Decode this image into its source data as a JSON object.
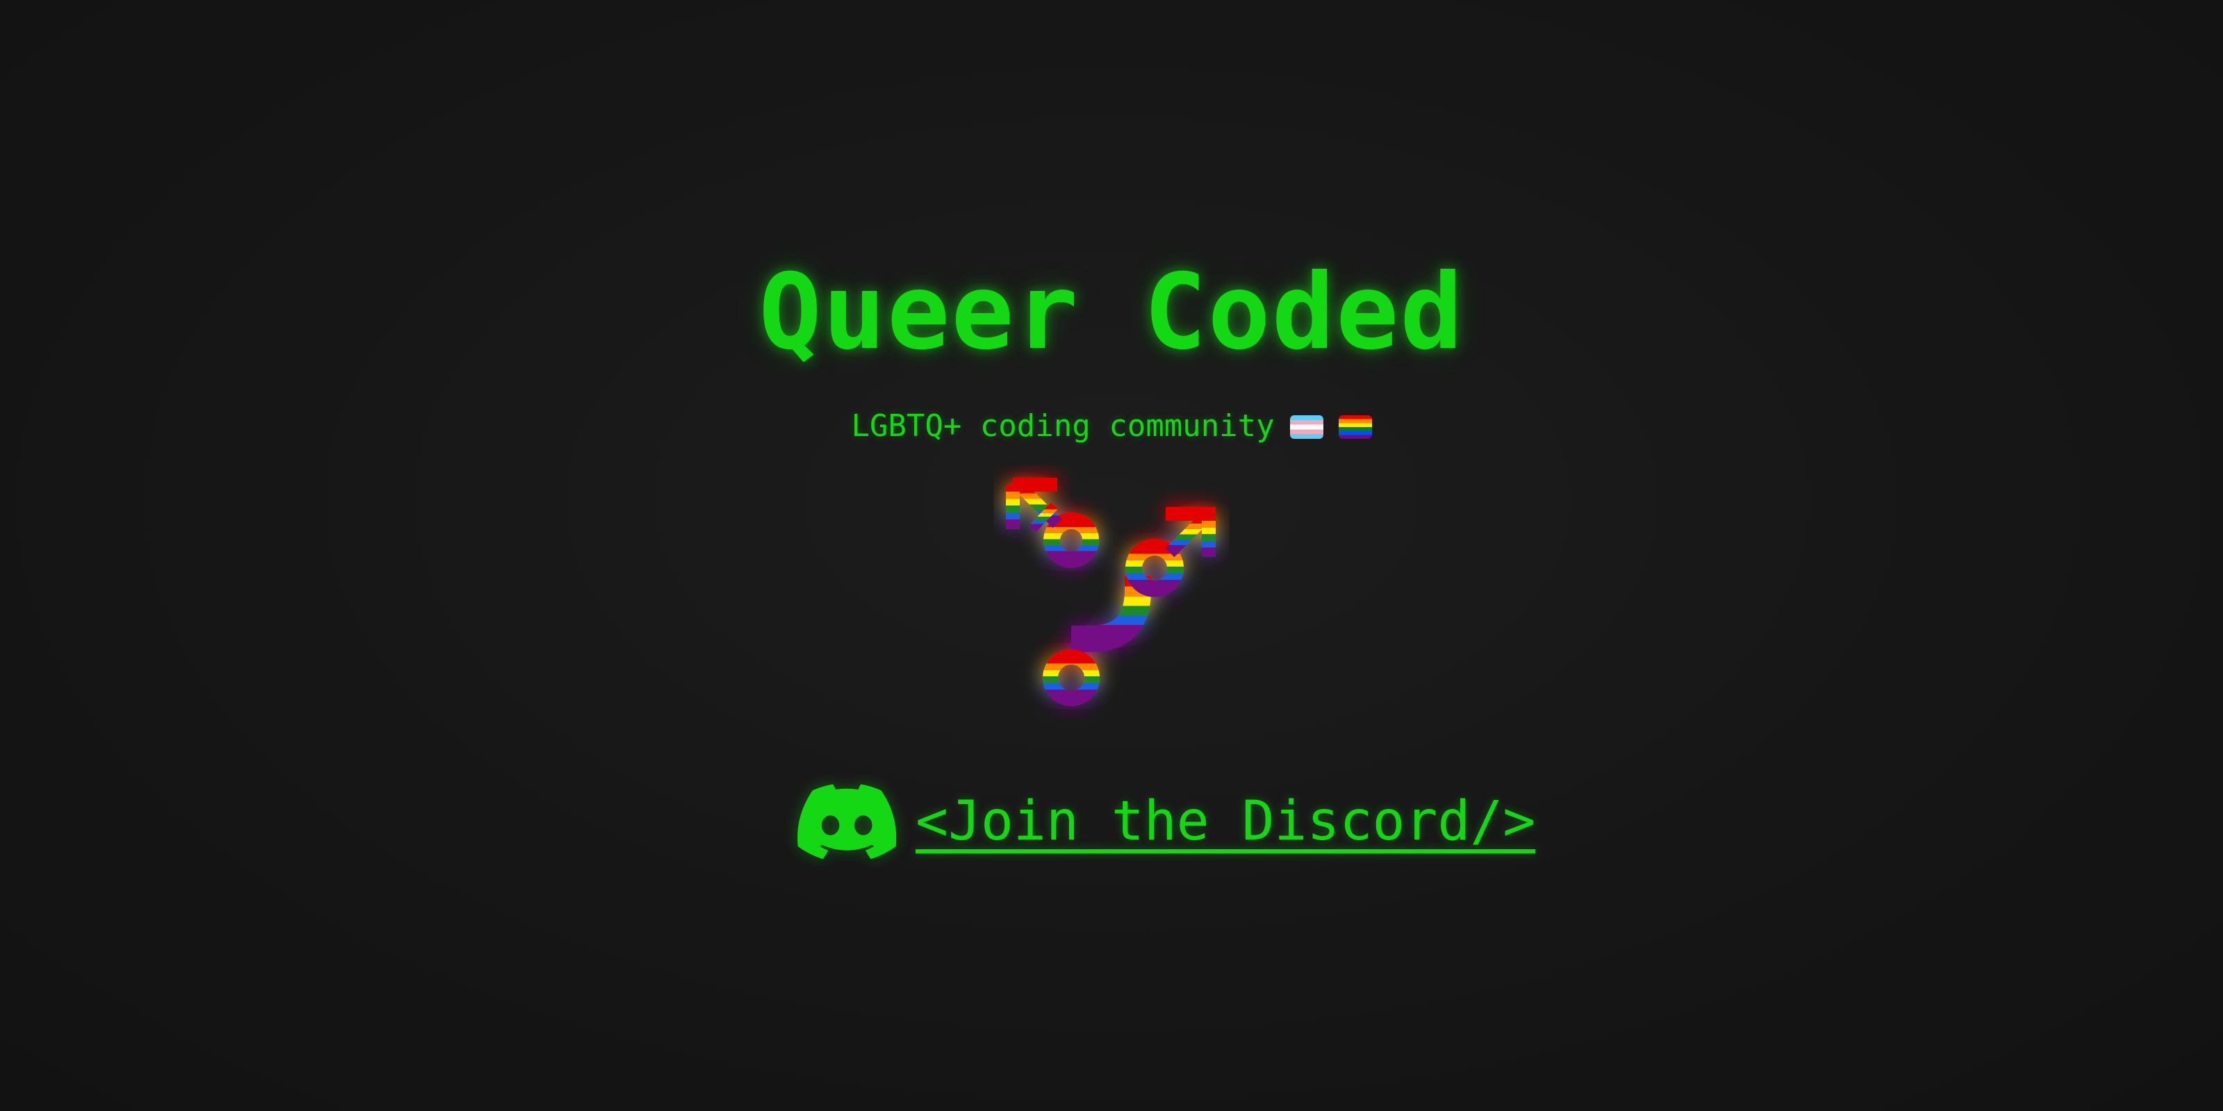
{
  "header": {
    "title": "Queer Coded",
    "subtitle": "LGBTQ+ coding community"
  },
  "flags": [
    {
      "name": "trans-flag-icon"
    },
    {
      "name": "rainbow-flag-icon"
    }
  ],
  "logo": {
    "icon": "combined-gender-symbol-icon",
    "colors": [
      "#e40303",
      "#ff8c00",
      "#ffed00",
      "#1f8a25",
      "#1f5fe0",
      "#750787"
    ]
  },
  "discord": {
    "icon": "discord-icon",
    "link_label": "<Join the Discord/>"
  },
  "colors": {
    "accent": "#14d814",
    "background": "#161616"
  }
}
